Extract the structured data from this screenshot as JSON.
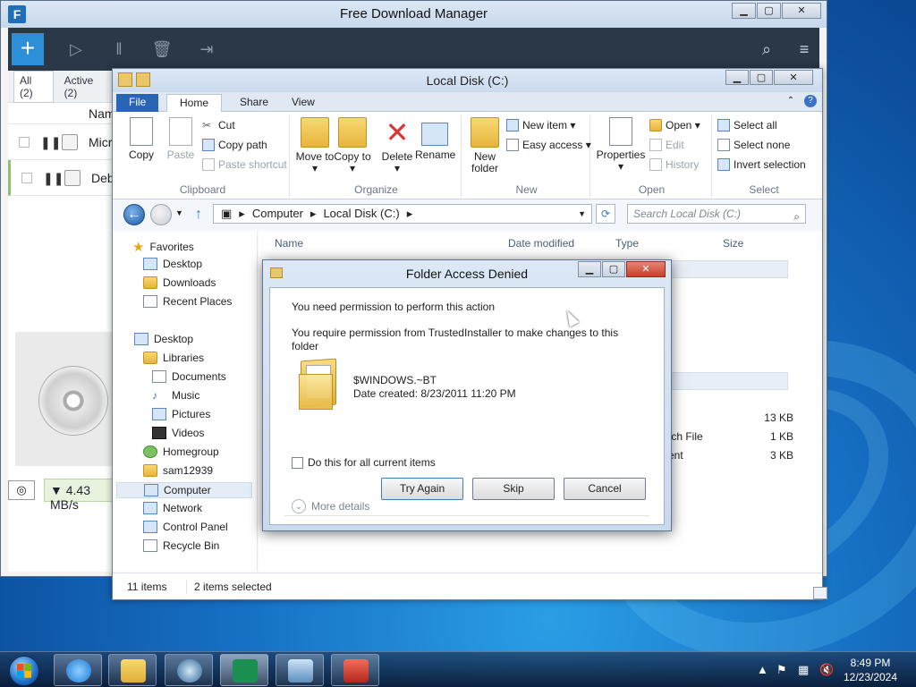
{
  "fdm": {
    "title": "Free Download Manager",
    "tabs": [
      "All (2)",
      "Active (2)"
    ],
    "column_name": "Name",
    "rows": [
      {
        "name": "Micr"
      },
      {
        "name": "Debi"
      }
    ],
    "speed": "▼ 4.43 MB/s"
  },
  "explorer": {
    "title": "Local Disk (C:)",
    "tabs": {
      "file": "File",
      "home": "Home",
      "share": "Share",
      "view": "View"
    },
    "ribbon": {
      "clipboard": {
        "label": "Clipboard",
        "copy": "Copy",
        "paste": "Paste",
        "cut": "Cut",
        "copy_path": "Copy path",
        "paste_shortcut": "Paste shortcut"
      },
      "organize": {
        "label": "Organize",
        "move_to": "Move to ▾",
        "copy_to": "Copy to ▾",
        "delete": "Delete ▾",
        "rename": "Rename"
      },
      "new": {
        "label": "New",
        "new_folder": "New folder",
        "new_item": "New item ▾",
        "easy_access": "Easy access ▾"
      },
      "open": {
        "label": "Open",
        "properties": "Properties ▾",
        "open": "Open ▾",
        "edit": "Edit",
        "history": "History"
      },
      "select": {
        "label": "Select",
        "select_all": "Select all",
        "select_none": "Select none",
        "invert": "Invert selection"
      }
    },
    "address": {
      "parts": [
        "Computer",
        "Local Disk (C:)"
      ],
      "sep": "▸"
    },
    "search_placeholder": "Search Local Disk (C:)",
    "nav": {
      "favorites": "Favorites",
      "desktop_fav": "Desktop",
      "downloads": "Downloads",
      "recent": "Recent Places",
      "desktop": "Desktop",
      "libraries": "Libraries",
      "documents": "Documents",
      "music": "Music",
      "pictures": "Pictures",
      "videos": "Videos",
      "homegroup": "Homegroup",
      "user": "sam12939",
      "computer": "Computer",
      "network": "Network",
      "control_panel": "Control Panel",
      "recycle_bin": "Recycle Bin"
    },
    "columns": {
      "name": "Name",
      "date": "Date modified",
      "type": "Type",
      "size": "Size"
    },
    "partial_rows": [
      {
        "type": "",
        "size": "13 KB"
      },
      {
        "type": "tch File",
        "size": "1 KB"
      },
      {
        "type": "ent",
        "size": "3 KB"
      }
    ],
    "status": {
      "items": "11 items",
      "selected": "2 items selected"
    }
  },
  "dialog": {
    "title": "Folder Access Denied",
    "line1": "You need permission to perform this action",
    "line2a": "You require permission from TrustedInstaller to make changes to this",
    "line2b": "folder",
    "folder_name": "$WINDOWS.~BT",
    "date_created": "Date created: 8/23/2011 11:20 PM",
    "checkbox": "Do this for all current items",
    "buttons": {
      "try_again": "Try Again",
      "skip": "Skip",
      "cancel": "Cancel"
    },
    "more_details": "More details"
  },
  "taskbar": {
    "time": "8:49 PM",
    "date": "12/23/2024"
  },
  "colors": {
    "accent": "#2a64b4",
    "fdm_toolbar": "#2a3848",
    "fdm_add": "#2c8fd8"
  }
}
